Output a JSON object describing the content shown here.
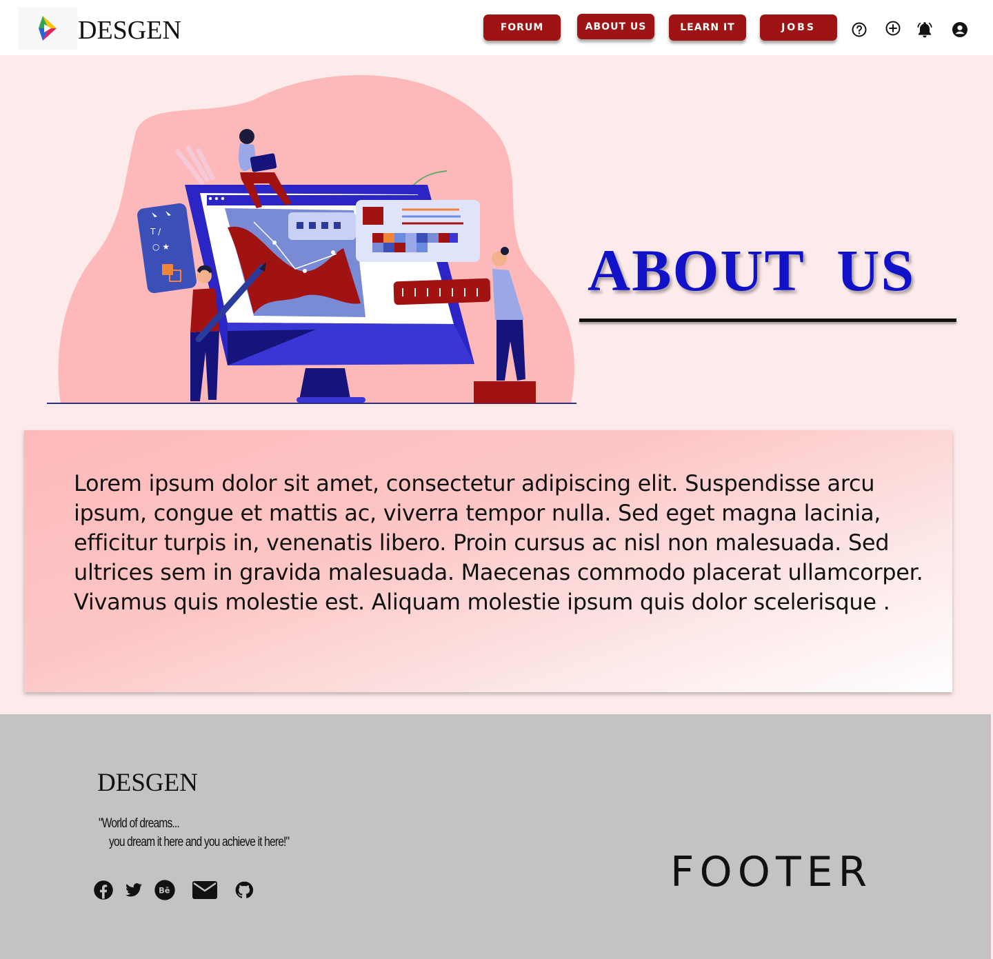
{
  "header": {
    "brand": "DESGEN",
    "nav": {
      "forum": "FORUM",
      "about": "ABOUT US",
      "learn": "LEARN IT",
      "jobs": "JOBS"
    },
    "icons": [
      "help-icon",
      "add-icon",
      "bell-icon",
      "account-icon"
    ]
  },
  "hero": {
    "title": "ABOUT  US",
    "illustration": "designers-around-monitor-illustration"
  },
  "content": {
    "text": "Lorem ipsum dolor sit amet, consectetur adipiscing elit. Suspendisse arcu ipsum, congue et mattis ac, viverra tempor nulla. Sed eget magna lacinia, efficitur turpis in, venenatis libero. Proin cursus ac nisl non malesuada. Sed ultrices sem in gravida malesuada. Maecenas commodo placerat ullamcorper. Vivamus quis molestie est. Aliquam molestie ipsum quis dolor scelerisque ."
  },
  "footer": {
    "brand": "DESGEN",
    "tagline_line1": "\"World of dreams...",
    "tagline_line2": "you dream it here and you achieve it here!\"",
    "title": "FOOTER",
    "social": [
      "facebook-icon",
      "twitter-icon",
      "behance-icon",
      "mail-icon",
      "github-icon"
    ]
  },
  "colors": {
    "nav_button": "#9e1414",
    "title_blue": "#1111c8",
    "page_bg": "#fdeaea",
    "footer_bg": "#c3c3c3",
    "blob_pink": "#fdb9b9"
  }
}
